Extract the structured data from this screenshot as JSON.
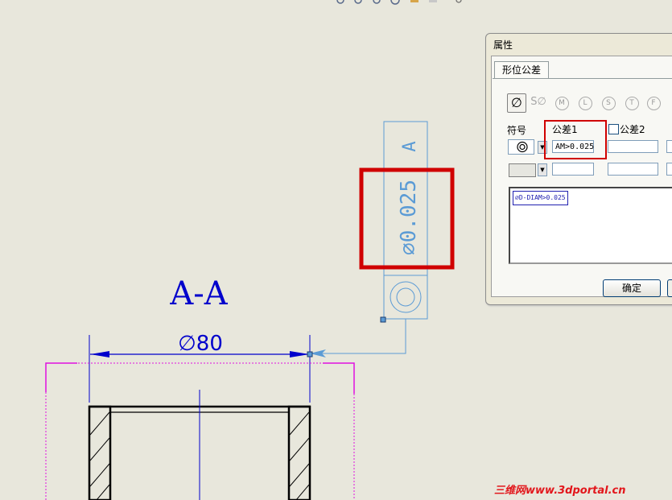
{
  "drawing": {
    "section_label": "A-A",
    "dimension_text": "∅80",
    "fcf_tolerance": "∅0.025",
    "fcf_datum": "A"
  },
  "dialog": {
    "title": "属性",
    "tab_label": "形位公差",
    "symbol_buttons": [
      "∅",
      "S∅",
      "M",
      "L",
      "S",
      "T",
      "F"
    ],
    "symbol_label": "符号",
    "tolerance1_label": "公差1",
    "tolerance2_label": "公差2",
    "tolerance1_value": "AM>0.025",
    "preview_text": "∅D-DIAM>0.025",
    "ok_label": "确定"
  },
  "watermark": "三维网www.3dportal.cn",
  "colors": {
    "background": "#e8e7dc",
    "drawing_blue": "#0000cc",
    "annotation_blue": "#5b9bd5",
    "magenta": "#e010e0",
    "highlight_red": "#d00000"
  }
}
